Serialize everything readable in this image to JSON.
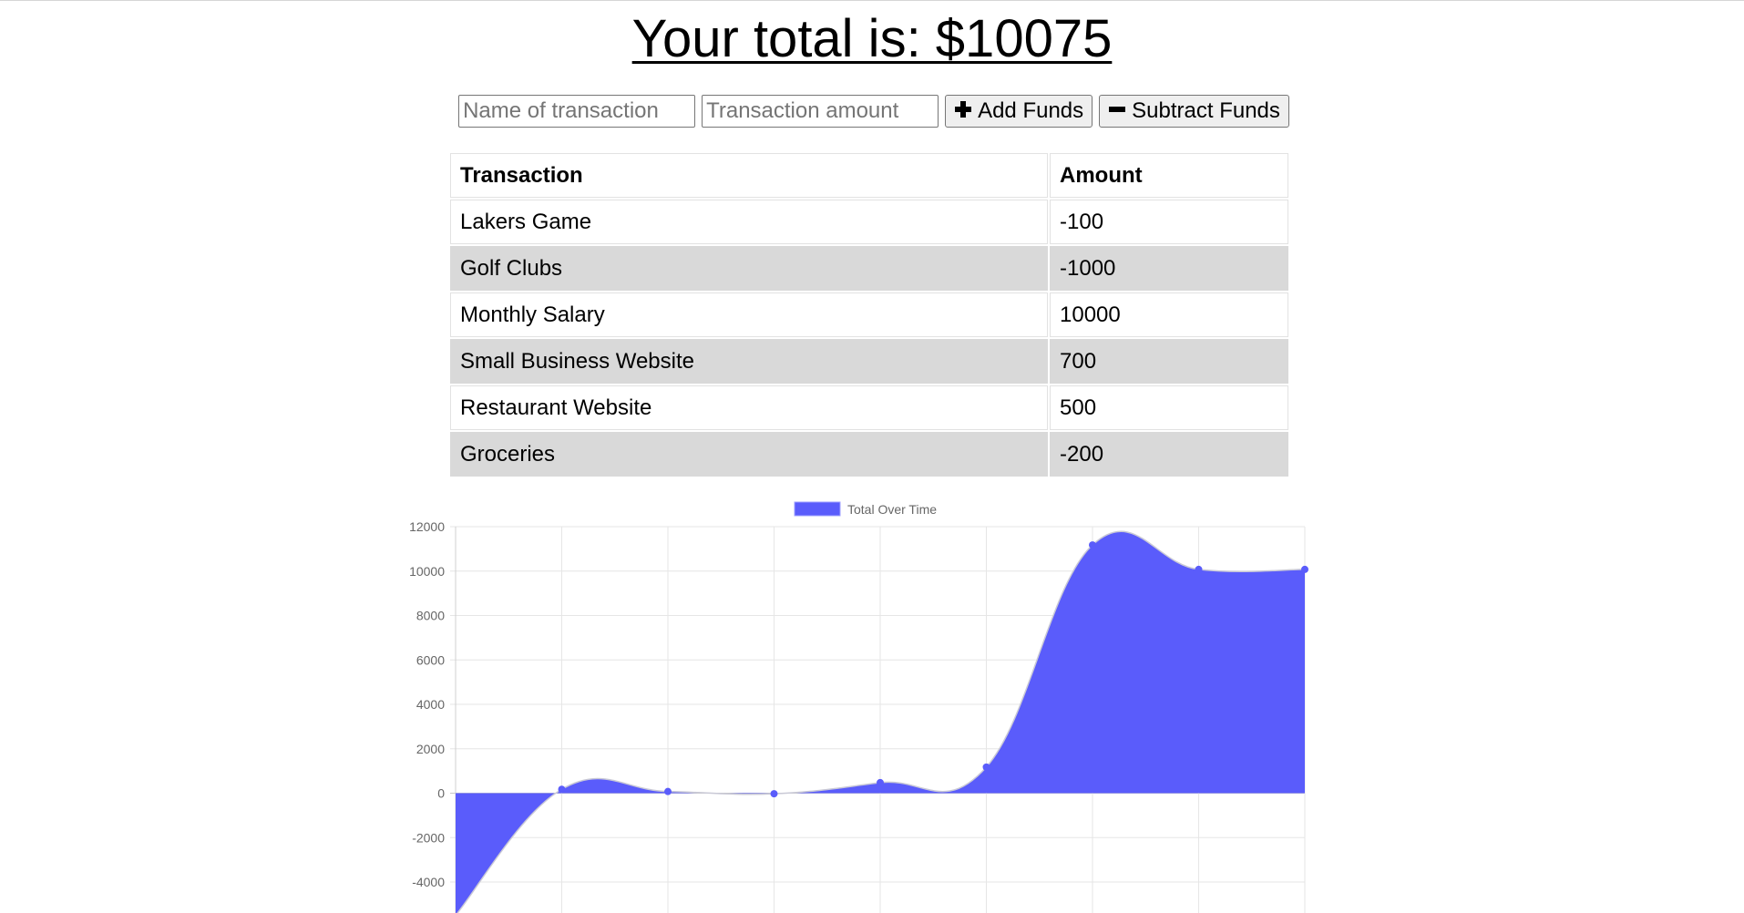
{
  "header": {
    "title": "Your total is: $10075"
  },
  "form": {
    "name_placeholder": "Name of transaction",
    "amount_placeholder": "Transaction amount",
    "add_label": "Add Funds",
    "subtract_label": "Subtract Funds",
    "add_icon": "plus-icon",
    "subtract_icon": "minus-icon"
  },
  "table": {
    "headers": [
      "Transaction",
      "Amount"
    ],
    "rows": [
      {
        "name": "Lakers Game",
        "amount": "-100"
      },
      {
        "name": "Golf Clubs",
        "amount": "-1000"
      },
      {
        "name": "Monthly Salary",
        "amount": "10000"
      },
      {
        "name": "Small Business Website",
        "amount": "700"
      },
      {
        "name": "Restaurant Website",
        "amount": "500"
      },
      {
        "name": "Groceries",
        "amount": "-200"
      }
    ],
    "stripe_color": "#d9d9d9"
  },
  "chart_data": {
    "type": "area",
    "legend": {
      "label": "Total Over Time",
      "position": "top-center",
      "color": "#5a5cfb"
    },
    "fill_color": "#5a5cfb",
    "x": [
      0,
      1,
      2,
      3,
      4,
      5,
      6,
      7,
      8
    ],
    "values": [
      -5500,
      175,
      75,
      -25,
      475,
      1175,
      11175,
      10075,
      10075
    ],
    "ylim": [
      -4000,
      12000
    ],
    "yticks": [
      12000,
      10000,
      8000,
      6000,
      4000,
      2000,
      0,
      -2000,
      -4000
    ],
    "grid": true,
    "title": "",
    "xlabel": "",
    "ylabel": ""
  }
}
